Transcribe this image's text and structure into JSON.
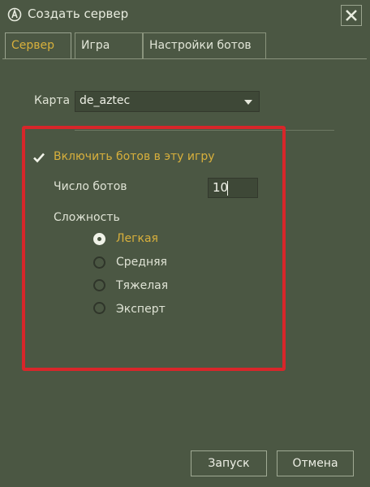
{
  "window": {
    "title": "Создать сервер",
    "close_icon": "close-icon"
  },
  "tabs": [
    {
      "label": "Сервер",
      "active": true
    },
    {
      "label": "Игра",
      "active": false
    },
    {
      "label": "Настройки ботов",
      "active": false
    }
  ],
  "server": {
    "map_label": "Карта",
    "map_value": "de_aztec"
  },
  "bots": {
    "enable_label": "Включить ботов в эту игру",
    "enable_checked": true,
    "count_label": "Число ботов",
    "count_value": "10",
    "difficulty_label": "Сложность",
    "difficulty_options": [
      {
        "label": "Легкая",
        "selected": true
      },
      {
        "label": "Средняя",
        "selected": false
      },
      {
        "label": "Тяжелая",
        "selected": false
      },
      {
        "label": "Эксперт",
        "selected": false
      }
    ]
  },
  "footer": {
    "start_label": "Запуск",
    "cancel_label": "Отмена"
  },
  "colors": {
    "accent": "#d8b03c",
    "highlight": "#d8262a",
    "background": "#4b5743"
  }
}
